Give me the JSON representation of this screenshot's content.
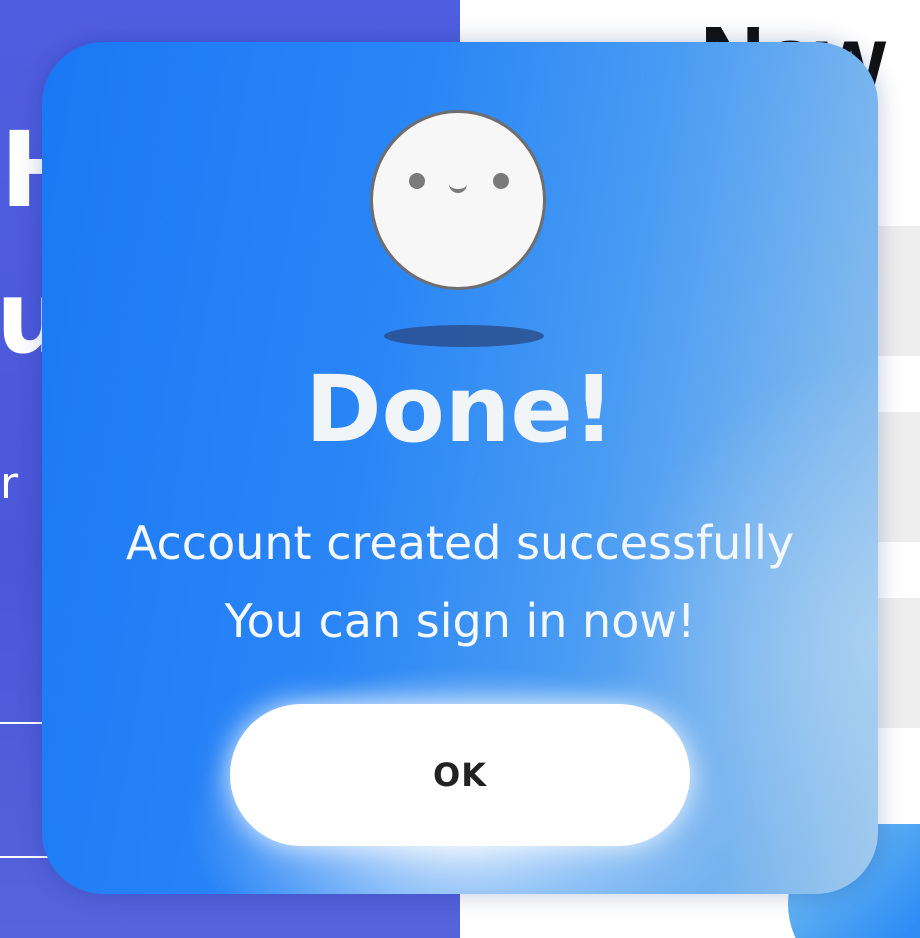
{
  "background": {
    "left_fragments": [
      "H",
      "u",
      "r"
    ],
    "right_heading_fragment": "Now"
  },
  "modal": {
    "icon": "smiley-face-icon",
    "title": "Done!",
    "message_line_1": "Account created successfully",
    "message_line_2": "You can sign in now!",
    "ok_label": "OK"
  },
  "colors": {
    "modal_gradient_start": "#1a78f5",
    "modal_gradient_end": "#9cc7ec",
    "background_left": "#4f5ee0",
    "button_background": "#ffffff",
    "button_text": "#222222"
  }
}
